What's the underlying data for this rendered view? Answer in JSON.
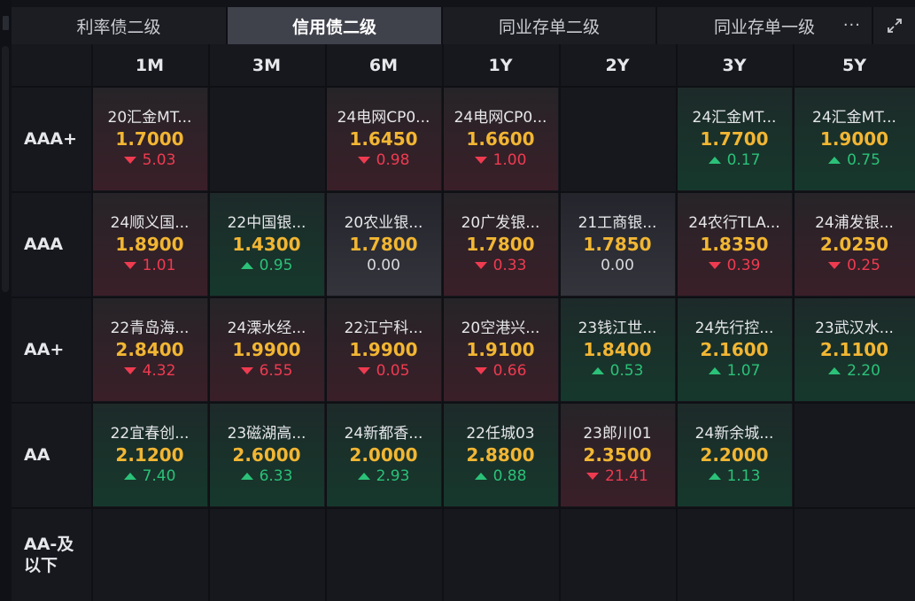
{
  "tabs": [
    {
      "label": "利率债二级",
      "active": false
    },
    {
      "label": "信用债二级",
      "active": true
    },
    {
      "label": "同业存单二级",
      "active": false
    },
    {
      "label": "同业存单一级",
      "active": false
    }
  ],
  "more_label": "···",
  "columns": [
    "1M",
    "3M",
    "6M",
    "1Y",
    "2Y",
    "3Y",
    "5Y"
  ],
  "rows": [
    {
      "label": "AAA+",
      "cells": [
        {
          "bond": "20汇金MT...",
          "rate": "1.7000",
          "change": "5.03",
          "dir": "down"
        },
        null,
        {
          "bond": "24电网CP0...",
          "rate": "1.6450",
          "change": "0.98",
          "dir": "down"
        },
        {
          "bond": "24电网CP0...",
          "rate": "1.6600",
          "change": "1.00",
          "dir": "down"
        },
        null,
        {
          "bond": "24汇金MT...",
          "rate": "1.7700",
          "change": "0.17",
          "dir": "up"
        },
        {
          "bond": "24汇金MT...",
          "rate": "1.9000",
          "change": "0.75",
          "dir": "up"
        }
      ]
    },
    {
      "label": "AAA",
      "cells": [
        {
          "bond": "24顺义国...",
          "rate": "1.8900",
          "change": "1.01",
          "dir": "down"
        },
        {
          "bond": "22中国银...",
          "rate": "1.4300",
          "change": "0.95",
          "dir": "up"
        },
        {
          "bond": "20农业银...",
          "rate": "1.7800",
          "change": "0.00",
          "dir": "flat"
        },
        {
          "bond": "20广发银...",
          "rate": "1.7800",
          "change": "0.33",
          "dir": "down"
        },
        {
          "bond": "21工商银...",
          "rate": "1.7850",
          "change": "0.00",
          "dir": "flat"
        },
        {
          "bond": "24农行TLA...",
          "rate": "1.8350",
          "change": "0.39",
          "dir": "down"
        },
        {
          "bond": "24浦发银...",
          "rate": "2.0250",
          "change": "0.25",
          "dir": "down"
        }
      ]
    },
    {
      "label": "AA+",
      "cells": [
        {
          "bond": "22青岛海...",
          "rate": "2.8400",
          "change": "4.32",
          "dir": "down"
        },
        {
          "bond": "24溧水经...",
          "rate": "1.9900",
          "change": "6.55",
          "dir": "down"
        },
        {
          "bond": "22江宁科...",
          "rate": "1.9900",
          "change": "0.05",
          "dir": "down"
        },
        {
          "bond": "20空港兴...",
          "rate": "1.9100",
          "change": "0.66",
          "dir": "down"
        },
        {
          "bond": "23钱江世...",
          "rate": "1.8400",
          "change": "0.53",
          "dir": "up"
        },
        {
          "bond": "24先行控...",
          "rate": "2.1600",
          "change": "1.07",
          "dir": "up"
        },
        {
          "bond": "23武汉水...",
          "rate": "2.1100",
          "change": "2.20",
          "dir": "up"
        }
      ]
    },
    {
      "label": "AA",
      "cells": [
        {
          "bond": "22宜春创...",
          "rate": "2.1200",
          "change": "7.40",
          "dir": "up"
        },
        {
          "bond": "23磁湖高...",
          "rate": "2.6000",
          "change": "6.33",
          "dir": "up"
        },
        {
          "bond": "24新都香...",
          "rate": "2.0000",
          "change": "2.93",
          "dir": "up"
        },
        {
          "bond": "22任城03",
          "rate": "2.8800",
          "change": "0.88",
          "dir": "up"
        },
        {
          "bond": "23郎川01",
          "rate": "2.3500",
          "change": "21.41",
          "dir": "down"
        },
        {
          "bond": "24新余城...",
          "rate": "2.2000",
          "change": "1.13",
          "dir": "up"
        },
        null
      ]
    },
    {
      "label": "AA-及以下",
      "cells": [
        null,
        null,
        null,
        null,
        null,
        null,
        null
      ]
    }
  ],
  "colors": {
    "rate": "#f2b633",
    "down": "#ef3b50",
    "up": "#2bc178",
    "active_tab": "#3f414b"
  }
}
